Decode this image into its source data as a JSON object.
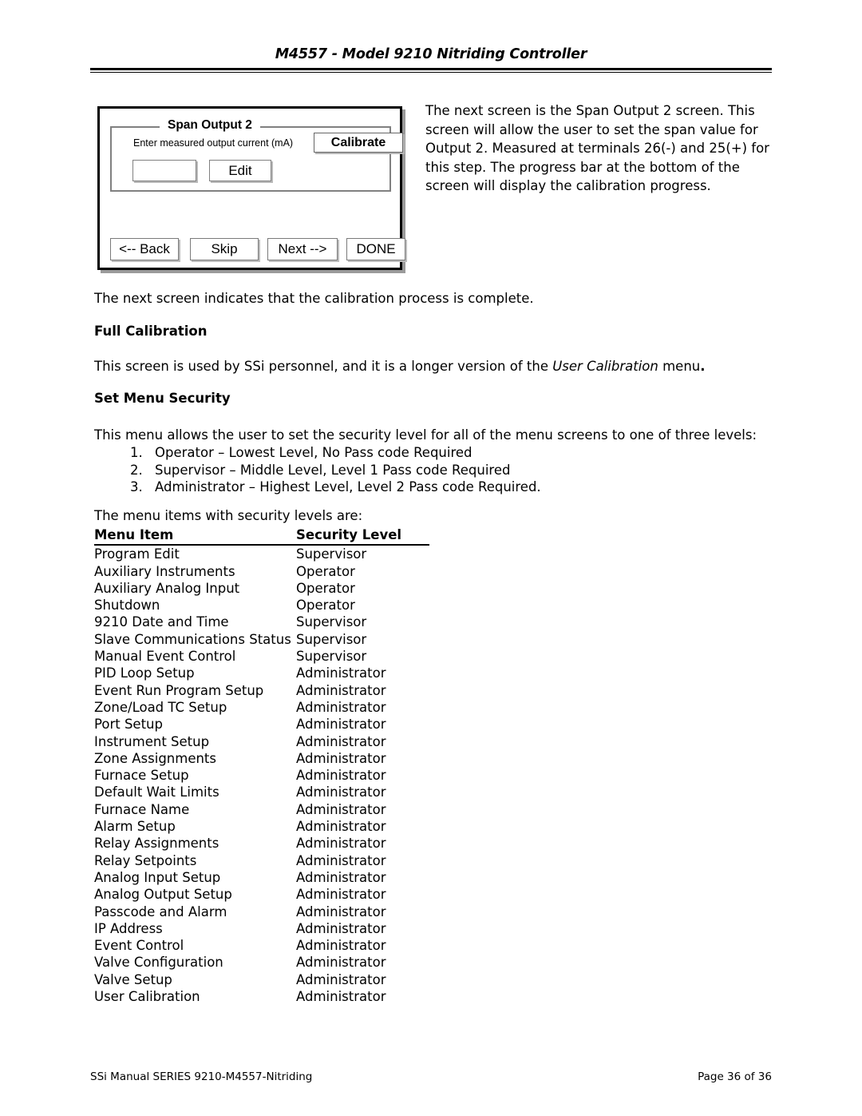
{
  "header": {
    "title": "M4557 - Model 9210 Nitriding Controller"
  },
  "dialog": {
    "group_title": "Span Output 2",
    "field_label": "Enter measured output current (mA)",
    "calibrate_label": "Calibrate",
    "input_value": "",
    "input_placeholder": "",
    "edit_label": "Edit",
    "nav_buttons": [
      {
        "label": "<-- Back",
        "name": "back-button"
      },
      {
        "label": "Skip",
        "name": "skip-button"
      },
      {
        "label": "Next -->",
        "name": "next-button"
      },
      {
        "label": "DONE",
        "name": "done-button"
      }
    ]
  },
  "body": {
    "intro_paragraph": "The next screen is the Span Output 2 screen.  This screen will allow the user to set the span value for Output 2.  Measured at terminals 26(-) and 25(+) for this step.  The progress bar at the bottom of the screen will display the calibration progress.",
    "paragraph_complete": "The next screen indicates that the calibration process is complete.",
    "heading_full_calibration": "Full Calibration",
    "full_calibration_before": "This screen is used by SSi personnel, and it is a longer version of the ",
    "full_calibration_italic": "User Calibration",
    "full_calibration_after": " menu",
    "full_calibration_period": ".",
    "heading_set_menu_security": "Set Menu Security",
    "paragraph_menu_security": "This menu allows the user to set the security level for all of the menu screens to one of three levels:",
    "levels": [
      "Operator – Lowest Level, No Pass code Required",
      "Supervisor – Middle Level, Level 1 Pass code Required",
      "Administrator – Highest Level, Level 2 Pass code Required."
    ],
    "paragraph_items_are": "The menu items with security levels are:"
  },
  "table": {
    "headers": [
      "Menu Item",
      "Security Level"
    ],
    "rows": [
      [
        "Program Edit",
        "Supervisor"
      ],
      [
        "Auxiliary Instruments",
        "Operator"
      ],
      [
        "Auxiliary Analog Input",
        "Operator"
      ],
      [
        "Shutdown",
        "Operator"
      ],
      [
        "9210 Date and Time",
        "Supervisor"
      ],
      [
        "Slave Communications Status",
        "Supervisor"
      ],
      [
        "Manual Event Control",
        "Supervisor"
      ],
      [
        "PID Loop Setup",
        "Administrator"
      ],
      [
        "Event Run Program Setup",
        "Administrator"
      ],
      [
        "Zone/Load TC Setup",
        "Administrator"
      ],
      [
        "Port Setup",
        "Administrator"
      ],
      [
        "Instrument Setup",
        "Administrator"
      ],
      [
        "Zone Assignments",
        "Administrator"
      ],
      [
        "Furnace Setup",
        "Administrator"
      ],
      [
        "Default Wait Limits",
        "Administrator"
      ],
      [
        "Furnace Name",
        "Administrator"
      ],
      [
        "Alarm Setup",
        "Administrator"
      ],
      [
        "Relay Assignments",
        "Administrator"
      ],
      [
        "Relay Setpoints",
        "Administrator"
      ],
      [
        "Analog Input Setup",
        "Administrator"
      ],
      [
        "Analog Output Setup",
        "Administrator"
      ],
      [
        "Passcode and Alarm",
        "Administrator"
      ],
      [
        "IP Address",
        "Administrator"
      ],
      [
        "Event Control",
        "Administrator"
      ],
      [
        "Valve Configuration",
        "Administrator"
      ],
      [
        "Valve Setup",
        "Administrator"
      ],
      [
        "User Calibration",
        "Administrator"
      ]
    ]
  },
  "footer": {
    "left": "SSi Manual SERIES 9210-M4557-Nitriding",
    "right": "Page 36 of 36"
  }
}
